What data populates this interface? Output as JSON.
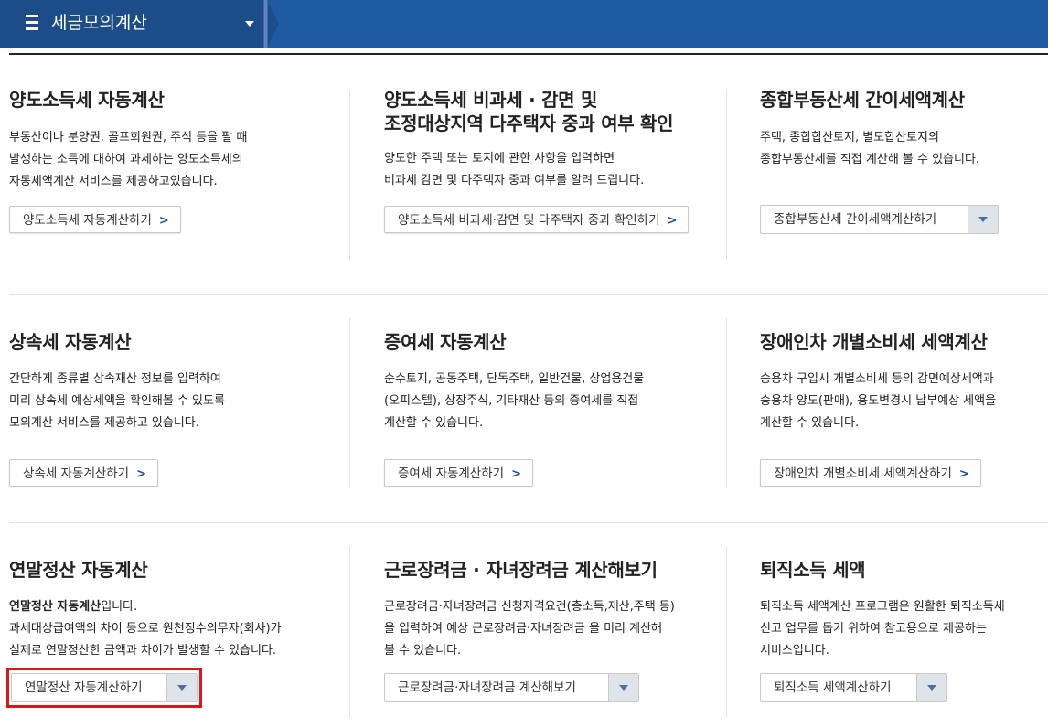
{
  "header": {
    "title": "세금모의계산"
  },
  "cards": [
    {
      "title": "양도소득세 자동계산",
      "desc": [
        "부동산이나 분양권, 골프회원권, 주식 등을 팔 때",
        "발생하는 소득에 대하여 과세하는 양도소득세의",
        "자동세액계산 서비스를 제공하고있습니다."
      ],
      "button": "양도소득세 자동계산하기"
    },
    {
      "title": "양도소득세 비과세 · 감면 및",
      "title2": "조정대상지역 다주택자 중과 여부 확인",
      "desc": [
        "양도한 주택 또는 토지에 관한 사항을 입력하면",
        "비과세 감면 및 다주택자 중과 여부를 알려 드립니다."
      ],
      "button": "양도소득세 비과세·감면 및 다주택자 중과 확인하기"
    },
    {
      "title": "종합부동산세 간이세액계산",
      "desc": [
        "주택, 종합합산토지, 별도합산토지의",
        "종합부동산세를 직접 계산해 볼 수 있습니다."
      ],
      "select": "종합부동산세 간이세액계산하기"
    },
    {
      "title": "상속세 자동계산",
      "desc": [
        "간단하게 종류별 상속재산 정보를 입력하여",
        "미리 상속세 예상세액을 확인해볼 수 있도록",
        "모의계산 서비스를 제공하고 있습니다."
      ],
      "button": "상속세 자동계산하기"
    },
    {
      "title": "증여세 자동계산",
      "desc": [
        "순수토지, 공동주택, 단독주택, 일반건물, 상업용건물",
        "(오피스텔), 상장주식, 기타재산 등의 증여세를 직접",
        "계산할 수 있습니다."
      ],
      "button": "증여세 자동계산하기"
    },
    {
      "title": "장애인차 개별소비세 세액계산",
      "desc": [
        "승용차 구입시 개별소비세 등의 감면예상세액과",
        "승용차 양도(판매), 용도변경시 납부예상 세액을",
        "계산할 수 있습니다."
      ],
      "button": "장애인차 개별소비세 세액계산하기"
    },
    {
      "title": "연말정산 자동계산",
      "desc_bold": "연말정산 자동계산",
      "desc_bold_suffix": "입니다.",
      "desc": [
        "과세대상급여액의 차이 등으로 원천징수의무자(회사)가",
        "실제로 연말정산한 금액과 차이가 발생할 수 있습니다."
      ],
      "select": "연말정산 자동계산하기"
    },
    {
      "title": "근로장려금 · 자녀장려금 계산해보기",
      "desc": [
        "근로장려금·자녀장려금 신청자격요건(총소득,재산,주택 등)",
        "을 입력하여 예상 근로장려금·자녀장려금 을 미리 계산해",
        "볼 수 있습니다."
      ],
      "select": "근로장려금·자녀장려금 계산해보기"
    },
    {
      "title": "퇴직소득 세액",
      "desc": [
        "퇴직소득 세액계산 프로그램은 원활한 퇴직소득세",
        "신고 업무를 돕기 위하여 참고용으로 제공하는",
        "서비스입니다."
      ],
      "select": "퇴직소득 세액계산하기"
    }
  ]
}
